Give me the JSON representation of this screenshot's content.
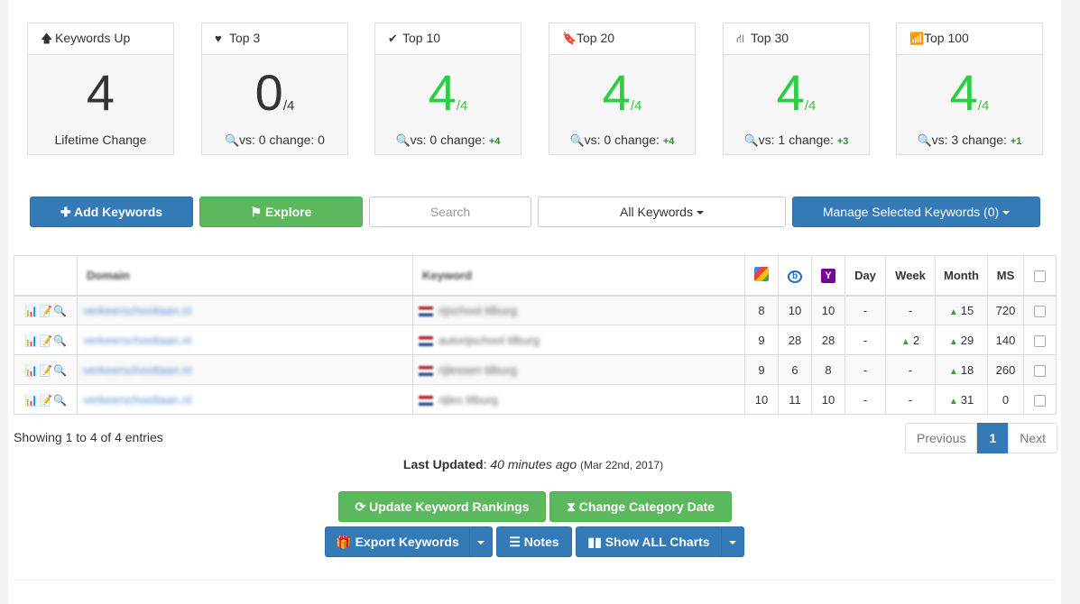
{
  "cards": [
    {
      "title": "Keywords Up",
      "icon": "arrow-up-icon",
      "glyph": "🡅",
      "value": "4",
      "denominator": "",
      "green": false,
      "footer": "Lifetime Change",
      "change": ""
    },
    {
      "title": "Top 3",
      "icon": "heart-icon",
      "glyph": "♥",
      "value": "0",
      "denominator": "/4",
      "green": false,
      "footer": "vs: 0 change: 0",
      "change": ""
    },
    {
      "title": "Top 10",
      "icon": "check-icon",
      "glyph": "✔",
      "value": "4",
      "denominator": "/4",
      "green": true,
      "footer": "vs: 0 change: ",
      "change": "+4"
    },
    {
      "title": "Top 20",
      "icon": "bookmark-icon",
      "glyph": "🔖",
      "value": "4",
      "denominator": "/4",
      "green": true,
      "footer": "vs: 0 change: ",
      "change": "+4"
    },
    {
      "title": "Top 30",
      "icon": "road-icon",
      "glyph": "⛙",
      "value": "4",
      "denominator": "/4",
      "green": true,
      "footer": "vs: 1 change: ",
      "change": "+3"
    },
    {
      "title": "Top 100",
      "icon": "signal-icon",
      "glyph": "📶",
      "value": "4",
      "denominator": "/4",
      "green": true,
      "footer": "vs: 3 change: ",
      "change": "+1"
    }
  ],
  "toolbar": {
    "add_keywords": "Add Keywords",
    "explore": "Explore",
    "search_placeholder": "Search",
    "all_keywords": "All Keywords",
    "manage_selected": "Manage Selected Keywords (0)"
  },
  "table": {
    "headers": {
      "domain": "Domain",
      "keyword": "Keyword",
      "day": "Day",
      "week": "Week",
      "month": "Month",
      "ms": "MS"
    },
    "rows": [
      {
        "domain": "verkeerschooltaan.nl",
        "keyword": "rijschool tilburg",
        "google": "8",
        "bing": "10",
        "yahoo": "10",
        "day": "-",
        "week": "-",
        "week_up": false,
        "month": "15",
        "month_up": true,
        "ms": "720"
      },
      {
        "domain": "verkeerschooltaan.nl",
        "keyword": "autorijschool tilburg",
        "google": "9",
        "bing": "28",
        "yahoo": "28",
        "day": "-",
        "week": "2",
        "week_up": true,
        "month": "29",
        "month_up": true,
        "ms": "140"
      },
      {
        "domain": "verkeerschooltaan.nl",
        "keyword": "rijlessen tilburg",
        "google": "9",
        "bing": "6",
        "yahoo": "8",
        "day": "-",
        "week": "-",
        "week_up": false,
        "month": "18",
        "month_up": true,
        "ms": "260"
      },
      {
        "domain": "verkeerschooltaan.nl",
        "keyword": "rijles tilburg",
        "google": "10",
        "bing": "11",
        "yahoo": "10",
        "day": "-",
        "week": "-",
        "week_up": false,
        "month": "31",
        "month_up": true,
        "ms": "0"
      }
    ]
  },
  "showing": "Showing 1 to 4 of 4 entries",
  "pager": {
    "previous": "Previous",
    "page": "1",
    "next": "Next"
  },
  "updated": {
    "label": "Last Updated",
    "ago": "40 minutes ago",
    "date": "(Mar 22nd, 2017)"
  },
  "actions": {
    "update_rankings": "Update Keyword Rankings",
    "change_category_date": "Change Category Date",
    "export_keywords": "Export Keywords",
    "notes": "Notes",
    "show_all_charts": "Show ALL Charts"
  },
  "colors": {
    "primary": "#337ab7",
    "success": "#5cb85c",
    "rank_green": "#2ecc40"
  }
}
